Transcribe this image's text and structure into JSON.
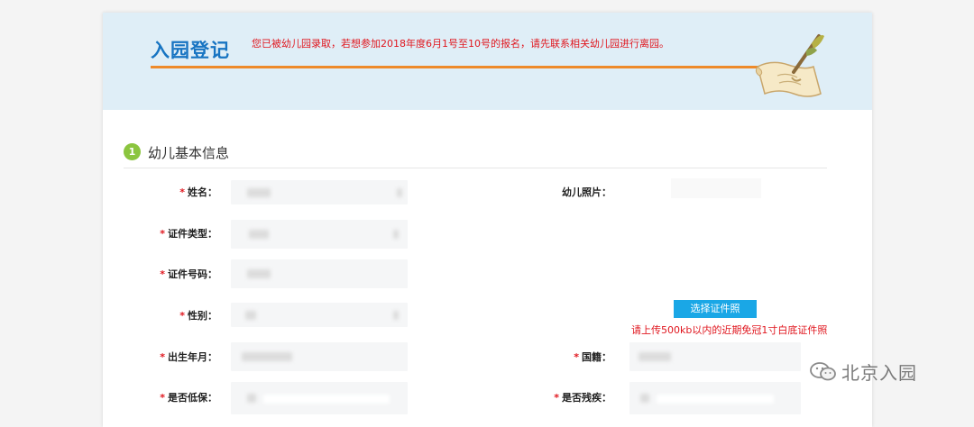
{
  "header": {
    "title": "入园登记",
    "notice": "您已被幼儿园录取，若想参加2018年度6月1号至10号的报名，请先联系相关幼儿园进行离园。"
  },
  "section": {
    "number": "1",
    "title": "幼儿基本信息"
  },
  "form": {
    "required_mark": "*",
    "labels": {
      "name": "姓名：",
      "id_type": "证件类型：",
      "id_number": "证件号码：",
      "gender": "性别：",
      "birth_date": "出生年月：",
      "low_income": "是否低保：",
      "photo": "幼儿照片：",
      "nationality": "国籍：",
      "disability": "是否残疾："
    }
  },
  "upload": {
    "button_label": "选择证件照",
    "hint": "请上传500kb以内的近期免冠1寸白底证件照"
  },
  "watermark": {
    "text": "北京入园",
    "icon": "wechat-icon"
  },
  "colors": {
    "title_blue": "#1774c2",
    "required_red": "#e0161e",
    "accent_orange": "#ee8a2a",
    "step_green": "#8bc53f",
    "button_blue": "#1aa7e6",
    "header_bg": "#dfeef7"
  }
}
